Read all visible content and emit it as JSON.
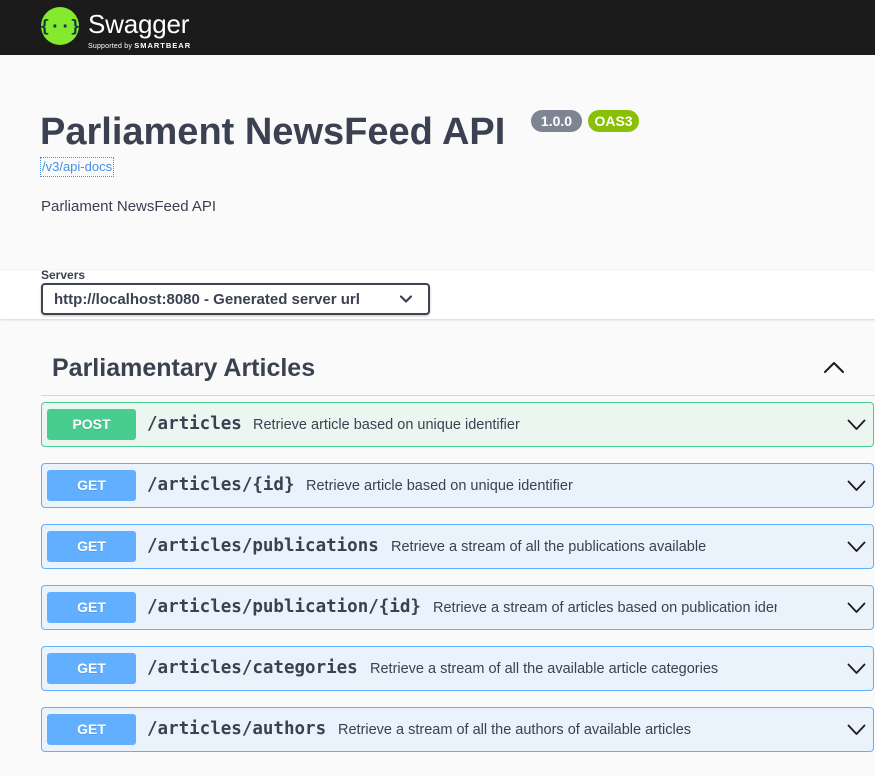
{
  "header": {
    "brand": "Swagger",
    "tagline_prefix": "Supported by",
    "tagline_brand": "SMARTBEAR",
    "logo_icon": "swagger-logo-icon"
  },
  "info": {
    "title": "Parliament NewsFeed API",
    "version": "1.0.0",
    "spec_badge": "OAS3",
    "docs_link": "/v3/api-docs",
    "description": "Parliament NewsFeed API"
  },
  "servers": {
    "label": "Servers",
    "selected": "http://localhost:8080 - Generated server url"
  },
  "section": {
    "title": "Parliamentary Articles",
    "expanded": true
  },
  "operations": [
    {
      "method": "POST",
      "path": "/articles",
      "summary": "Retrieve article based on unique identifier"
    },
    {
      "method": "GET",
      "path": "/articles/{id}",
      "summary": "Retrieve article based on unique identifier"
    },
    {
      "method": "GET",
      "path": "/articles/publications",
      "summary": "Retrieve a stream of all the publications available"
    },
    {
      "method": "GET",
      "path": "/articles/publication/{id}",
      "summary": "Retrieve a stream of articles based on publication iden"
    },
    {
      "method": "GET",
      "path": "/articles/categories",
      "summary": "Retrieve a stream of all the available article categories"
    },
    {
      "method": "GET",
      "path": "/articles/authors",
      "summary": "Retrieve a stream of all the authors of available articles"
    }
  ],
  "colors": {
    "topbar": "#1b1b1b",
    "logo": "#85ea2d",
    "post": "#49cc90",
    "get": "#61affe",
    "version_badge": "#7d8492",
    "oas_badge": "#89bf04",
    "text": "#3b4151"
  }
}
